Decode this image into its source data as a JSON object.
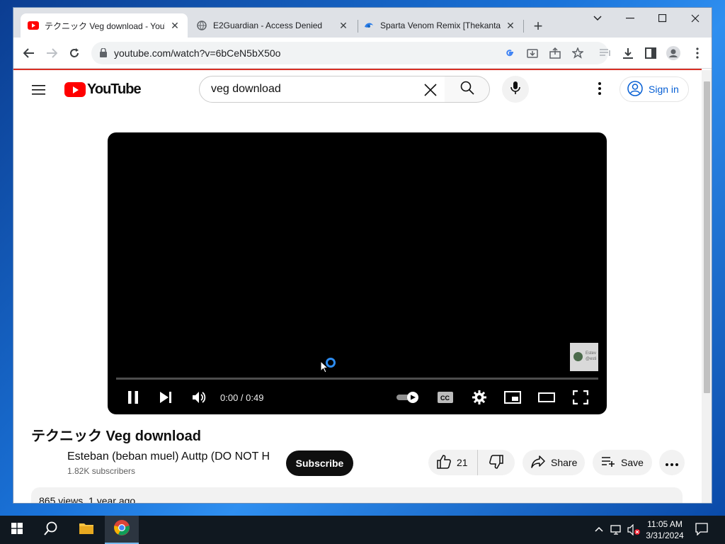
{
  "browser": {
    "tabs": [
      {
        "title": "テクニック Veg download - YouTube",
        "icon": "youtube-favicon",
        "active": true
      },
      {
        "title": "E2Guardian - Access Denied",
        "icon": "globe-icon",
        "active": false
      },
      {
        "title": "Sparta Venom Remix [Thekantapon",
        "icon": "swirl-favicon",
        "active": false
      }
    ],
    "url": "youtube.com/watch?v=6bCeN5bX50o"
  },
  "youtube": {
    "logo_text": "YouTube",
    "search_value": "veg download",
    "sign_in": "Sign in",
    "player": {
      "time": "0:00 / 0:49",
      "progress": 0,
      "endscreen_line1": "Estev",
      "endscreen_line2": "@esti"
    },
    "video_title": "テクニック Veg download",
    "channel_name": "Esteban (beban muel) Auttp (DO NOT HATE)",
    "subscribers": "1.82K subscribers",
    "subscribe": "Subscribe",
    "likes": "21",
    "share": "Share",
    "save": "Save",
    "views": "865 views",
    "uploaded": "1 year ago"
  },
  "taskbar": {
    "time": "11:05 AM",
    "date": "3/31/2024"
  },
  "colors": {
    "youtube_red": "#ff0000",
    "link_blue": "#065fd4",
    "omnibox_bg": "#f1f3f4"
  }
}
